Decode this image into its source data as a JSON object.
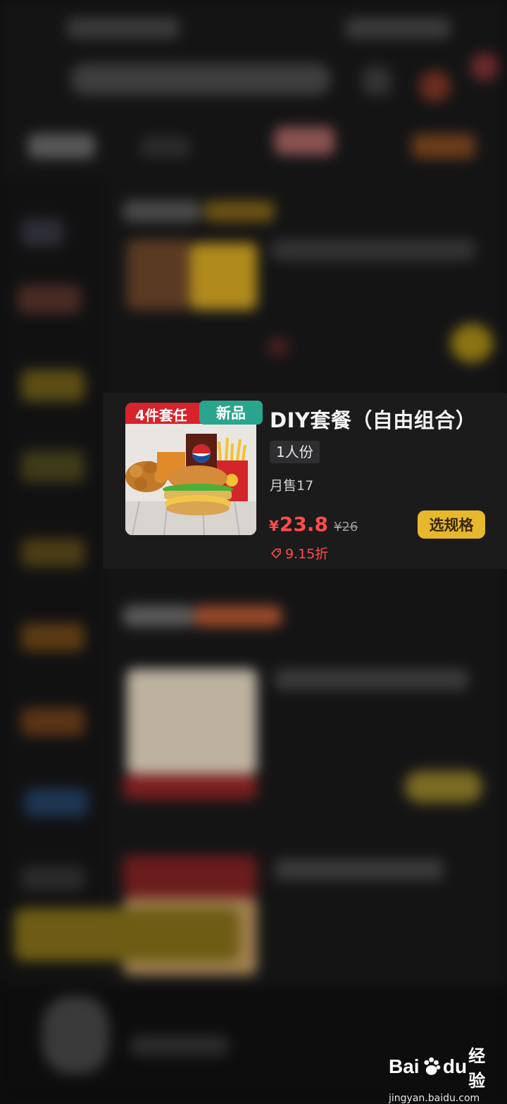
{
  "product": {
    "image_banner": "4件套任",
    "new_tag": "新品",
    "title": "DIY套餐（自由组合）",
    "portion": "1人份",
    "sales": "月售17",
    "currency": "¥",
    "price": "23.8",
    "original_price": "¥26",
    "discount": "9.15折",
    "spec_button": "选规格"
  },
  "watermark": {
    "brand": "Bai",
    "brand_suffix": "du",
    "brand_cn": "经验",
    "url": "jingyan.baidu.com"
  },
  "colors": {
    "accent_red": "#ff4d4a",
    "accent_yellow": "#e8b82c",
    "tag_green": "#2aa58d"
  }
}
